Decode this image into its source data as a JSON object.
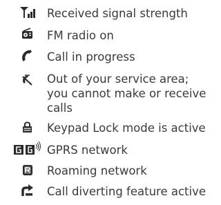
{
  "colors": {
    "text": "#3a3a3a",
    "icon": "#2b2b2b"
  },
  "icon_list": [
    {
      "icon": "signal-strength-icon",
      "lines": [
        "Received signal strength"
      ]
    },
    {
      "icon": "fm-radio-icon",
      "lines": [
        "FM radio on"
      ]
    },
    {
      "icon": "phone-handset-icon",
      "lines": [
        "Call in progress"
      ]
    },
    {
      "icon": "no-service-icon",
      "lines": [
        "Out of your service area;",
        "you cannot make or receive",
        "calls"
      ]
    },
    {
      "icon": "padlock-icon",
      "lines": [
        "Keypad Lock mode is active"
      ]
    },
    {
      "icon": "gprs-network-icon",
      "lines": [
        "GPRS network"
      ]
    },
    {
      "icon": "roaming-icon",
      "lines": [
        "Roaming network"
      ]
    },
    {
      "icon": "call-divert-icon",
      "lines": [
        "Call diverting feature active"
      ]
    }
  ]
}
